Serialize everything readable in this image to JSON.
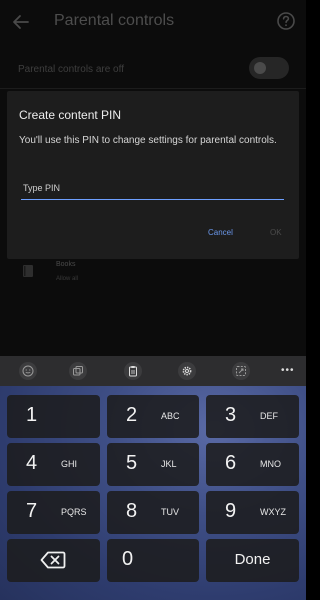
{
  "header": {
    "title": "Parental controls"
  },
  "settings": {
    "parental_status": "Parental controls are off",
    "toggle_on": false
  },
  "list": {
    "books_title": "Books",
    "books_subtitle": "Allow all"
  },
  "dialog": {
    "title": "Create content PIN",
    "body": "You'll use this PIN to change settings for parental controls.",
    "pin_placeholder": "Type PIN",
    "pin_value": "",
    "cancel_label": "Cancel",
    "ok_label": "OK",
    "accent_color": "#6ea0ff"
  },
  "keyboard": {
    "toolbar_icons": [
      "emoji-icon",
      "sticker-icon",
      "clipboard-icon",
      "settings-icon",
      "resize-icon",
      "more-icon"
    ],
    "more_label": "•••",
    "keys": [
      {
        "digit": "1",
        "letters": ""
      },
      {
        "digit": "2",
        "letters": "ABC"
      },
      {
        "digit": "3",
        "letters": "DEF"
      },
      {
        "digit": "4",
        "letters": "GHI"
      },
      {
        "digit": "5",
        "letters": "JKL"
      },
      {
        "digit": "6",
        "letters": "MNO"
      },
      {
        "digit": "7",
        "letters": "PQRS"
      },
      {
        "digit": "8",
        "letters": "TUV"
      },
      {
        "digit": "9",
        "letters": "WXYZ"
      }
    ],
    "zero": "0",
    "done_label": "Done"
  }
}
